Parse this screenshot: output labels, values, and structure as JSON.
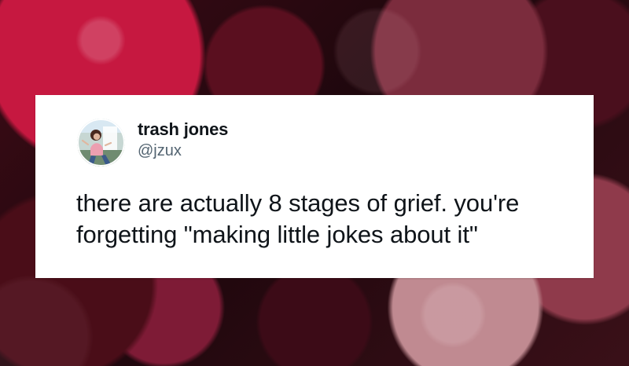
{
  "tweet": {
    "display_name": "trash jones",
    "handle": "@jzux",
    "text": "there are actually 8 stages of grief. you're\nforgetting \"making little jokes about it\""
  }
}
